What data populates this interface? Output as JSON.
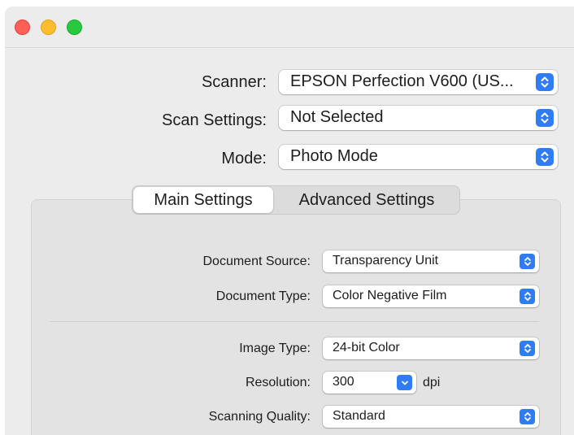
{
  "window": {
    "traffic_lights": [
      "close",
      "minimize",
      "zoom"
    ]
  },
  "scanner": {
    "label": "Scanner:",
    "value": "EPSON Perfection V600 (US..."
  },
  "scan_settings": {
    "label": "Scan Settings:",
    "value": "Not Selected"
  },
  "mode": {
    "label": "Mode:",
    "value": "Photo Mode"
  },
  "tabs": {
    "items": [
      {
        "label": "Main Settings",
        "selected": true
      },
      {
        "label": "Advanced Settings",
        "selected": false
      }
    ]
  },
  "main": {
    "document_source": {
      "label": "Document Source:",
      "value": "Transparency Unit"
    },
    "document_type": {
      "label": "Document Type:",
      "value": "Color Negative Film"
    },
    "image_type": {
      "label": "Image Type:",
      "value": "24-bit Color"
    },
    "resolution": {
      "label": "Resolution:",
      "value": "300",
      "unit": "dpi"
    },
    "scanning_quality": {
      "label": "Scanning Quality:",
      "value": "Standard"
    }
  },
  "colors": {
    "accent": "#2f7cf6",
    "close": "#fe5f57",
    "minimize": "#febc2e",
    "zoom": "#28c840"
  }
}
